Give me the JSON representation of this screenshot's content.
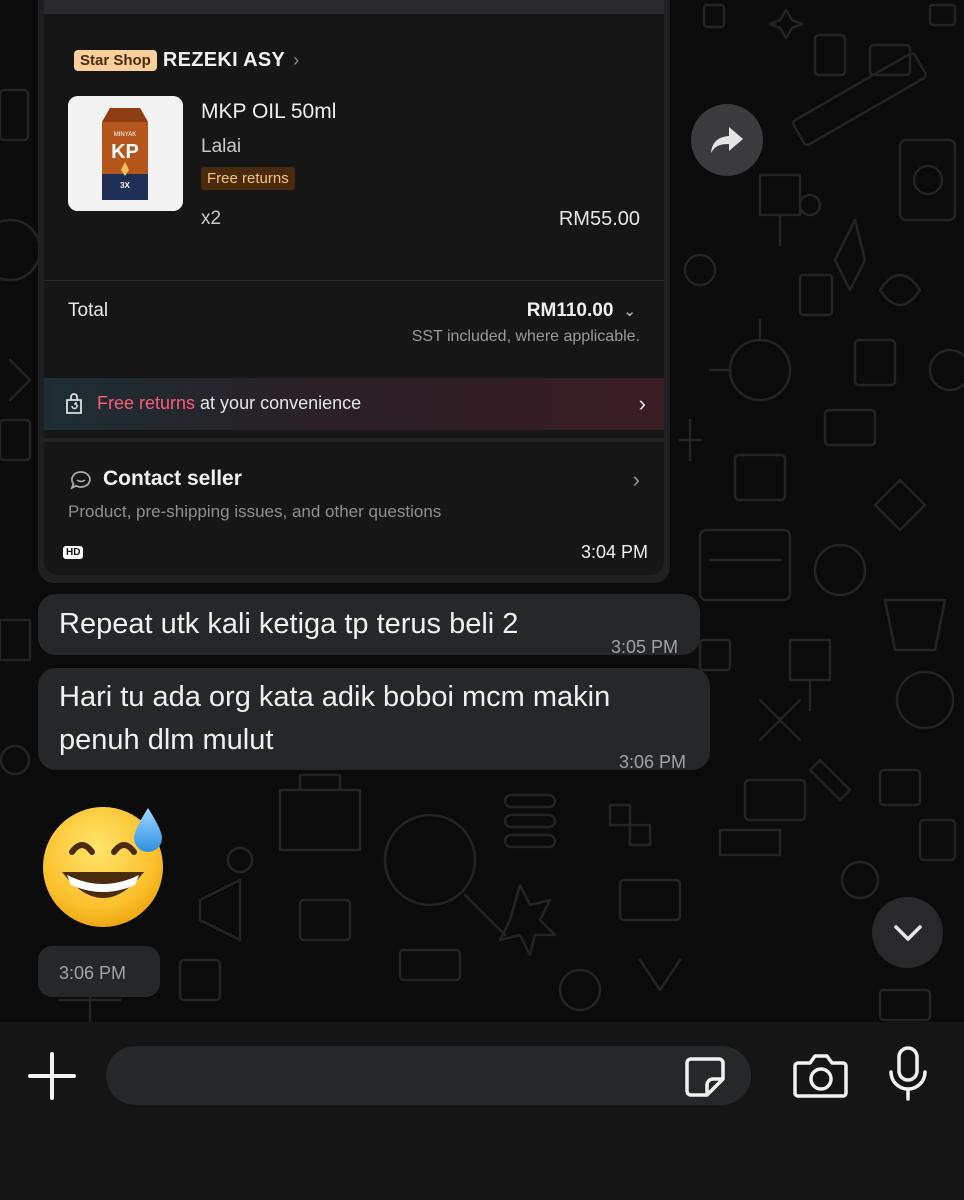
{
  "image_message": {
    "shop_badge": "Star Shop",
    "shop_name": "REZEKI ASY",
    "product": {
      "name": "MKP OIL 50ml",
      "variant": "Lalai",
      "badge": "Free returns",
      "quantity": "x2",
      "price": "RM55.00",
      "image_text": "KP"
    },
    "total_label": "Total",
    "total_value": "RM110.00",
    "tax_note": "SST included, where applicable.",
    "returns_highlight": "Free returns",
    "returns_rest": " at your convenience",
    "contact_title": "Contact seller",
    "contact_subtitle": "Product, pre-shipping issues, and other questions",
    "hd_label": "HD",
    "time": "3:04 PM"
  },
  "messages": [
    {
      "text": "Repeat utk kali ketiga tp terus beli 2",
      "time": "3:05 PM"
    },
    {
      "line1": "Hari tu ada org kata adik boboi mcm makin",
      "line2": "penuh dlm mulut",
      "time": "3:06 PM"
    },
    {
      "emoji": "grinning-face-with-sweat",
      "time": "3:06 PM"
    }
  ],
  "composer": {
    "placeholder": ""
  },
  "icons": [
    "forward-icon",
    "chevron-down-icon",
    "plus-icon",
    "sticker-icon",
    "camera-icon",
    "microphone-icon"
  ]
}
